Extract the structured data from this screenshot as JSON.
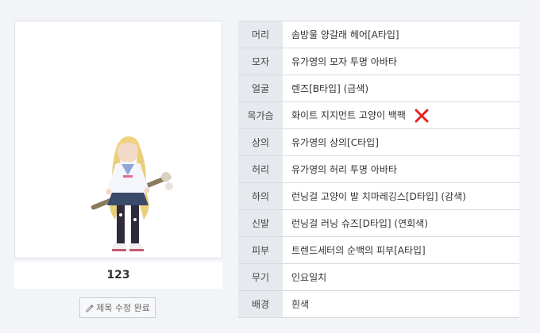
{
  "character": {
    "name": "123",
    "edit_button_label": "제목 수정 완료",
    "edit_icon": "pencil-icon"
  },
  "equipment": [
    {
      "slot": "머리",
      "item": "솜방울 양갈래 헤어[A타입]",
      "marked_wrong": false
    },
    {
      "slot": "모자",
      "item": "유가영의 모자 투명 아바타",
      "marked_wrong": false
    },
    {
      "slot": "얼굴",
      "item": "렌즈[B타입] (금색)",
      "marked_wrong": false
    },
    {
      "slot": "목가슴",
      "item": "화이트 지지먼트 고양이 백팩",
      "marked_wrong": true
    },
    {
      "slot": "상의",
      "item": "유가영의 상의[C타입]",
      "marked_wrong": false
    },
    {
      "slot": "허리",
      "item": "유가영의 허리 투명 아바타",
      "marked_wrong": false
    },
    {
      "slot": "하의",
      "item": "런닝걸 고양이 발 치마레깅스[D타입] (감색)",
      "marked_wrong": false
    },
    {
      "slot": "신발",
      "item": "런닝걸 러닝 슈즈[D타입] (연회색)",
      "marked_wrong": false
    },
    {
      "slot": "피부",
      "item": "트렌드세터의 순백의 피부[A타입]",
      "marked_wrong": false
    },
    {
      "slot": "무기",
      "item": "인요일치",
      "marked_wrong": false
    },
    {
      "slot": "배경",
      "item": "흰색",
      "marked_wrong": false
    }
  ],
  "colors": {
    "page_bg": "#f2f4f7",
    "label_cell_bg": "#e6e9ee",
    "x_mark": "#e02424"
  }
}
